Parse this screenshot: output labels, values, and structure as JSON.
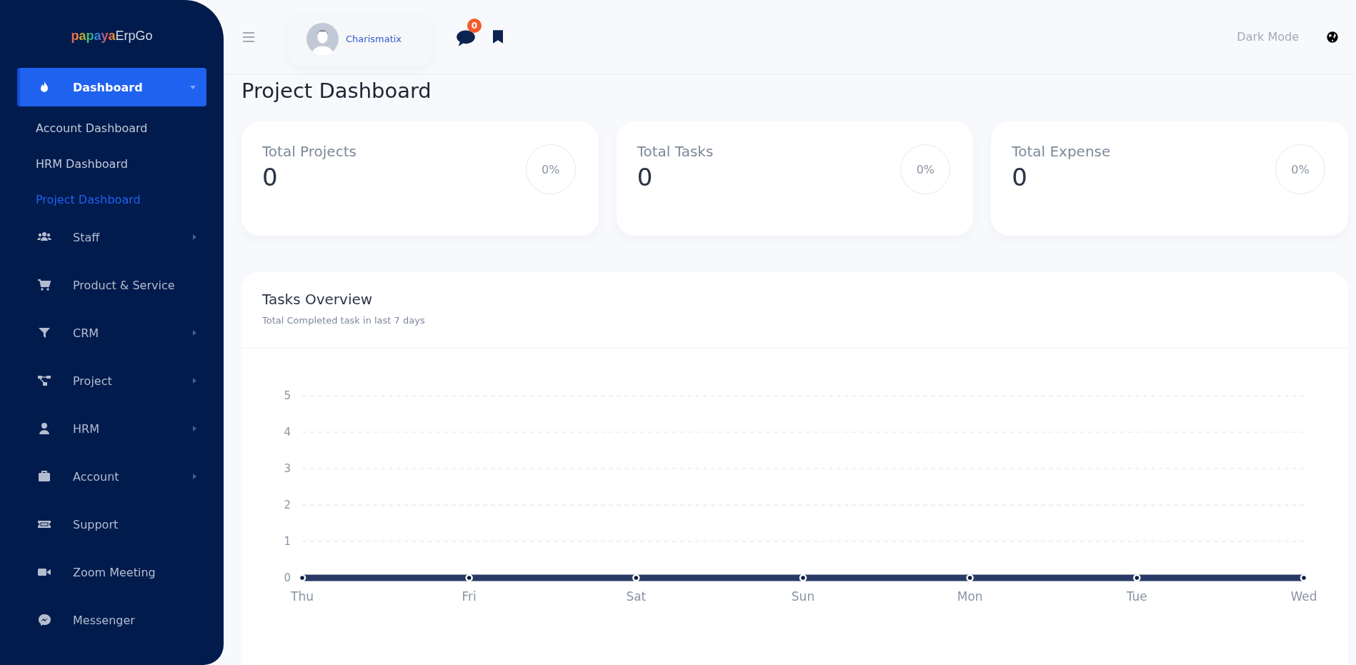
{
  "logo": {
    "brand": "papaya",
    "suffix": "ErpGo"
  },
  "sidebar": {
    "items": [
      {
        "label": "Dashboard",
        "selected": true,
        "expandable": true,
        "expanded": true,
        "children": [
          {
            "label": "Account Dashboard",
            "selected": false
          },
          {
            "label": "HRM Dashboard",
            "selected": false
          },
          {
            "label": "Project Dashboard",
            "selected": true
          }
        ]
      },
      {
        "label": "Staff",
        "selected": false,
        "expandable": true,
        "expanded": false
      },
      {
        "label": "Product & Service",
        "selected": false,
        "expandable": false
      },
      {
        "label": "CRM",
        "selected": false,
        "expandable": true,
        "expanded": false
      },
      {
        "label": "Project",
        "selected": false,
        "expandable": true,
        "expanded": false
      },
      {
        "label": "HRM",
        "selected": false,
        "expandable": true,
        "expanded": false
      },
      {
        "label": "Account",
        "selected": false,
        "expandable": true,
        "expanded": false
      },
      {
        "label": "Support",
        "selected": false,
        "expandable": false
      },
      {
        "label": "Zoom Meeting",
        "selected": false,
        "expandable": false
      },
      {
        "label": "Messenger",
        "selected": false,
        "expandable": false
      }
    ]
  },
  "topbar": {
    "user": "Charismatix",
    "message_count": "0",
    "dark_mode": "Dark Mode"
  },
  "page_title": "Project Dashboard",
  "stats": [
    {
      "title": "Total Projects",
      "value": "0",
      "percent": "0%"
    },
    {
      "title": "Total Tasks",
      "value": "0",
      "percent": "0%"
    },
    {
      "title": "Total Expense",
      "value": "0",
      "percent": "0%"
    }
  ],
  "tasks_overview": {
    "title": "Tasks Overview",
    "subtitle": "Total Completed task in last 7 days",
    "chart_data": {
      "type": "line",
      "grid": true,
      "categories": [
        "Thu",
        "Fri",
        "Sat",
        "Sun",
        "Mon",
        "Tue",
        "Wed"
      ],
      "series": [
        {
          "color": "#293a66",
          "marker": "circle",
          "values": [
            0,
            0,
            0,
            0,
            0,
            0,
            0
          ]
        }
      ],
      "ylim": [
        0,
        5
      ],
      "yticks": [
        0,
        1,
        2,
        3,
        4,
        5
      ]
    }
  }
}
